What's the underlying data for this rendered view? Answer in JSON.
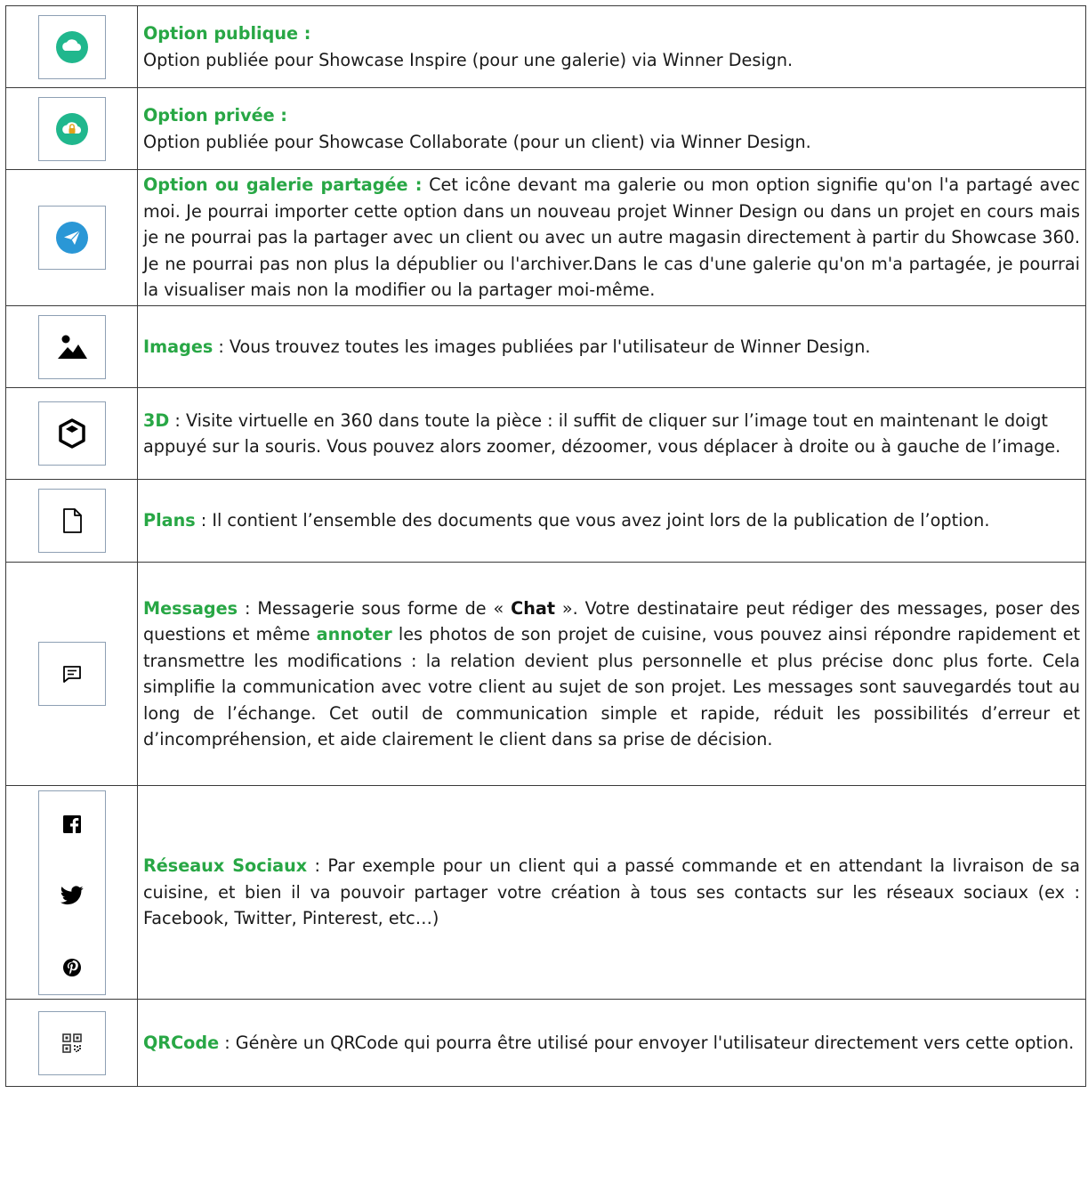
{
  "colors": {
    "accent": "#28a745",
    "icon_teal": "#20b78d",
    "icon_blue": "#2a97d6",
    "border": "#3a3a3a"
  },
  "rows": [
    {
      "icon": "cloud-icon",
      "title": "Option publique :",
      "desc": "Option publiée pour Showcase Inspire (pour une galerie) via Winner Design."
    },
    {
      "icon": "cloud-lock-icon",
      "title": "Option privée :",
      "desc": "Option publiée pour Showcase Collaborate (pour un client) via Winner Design."
    },
    {
      "icon": "send-icon",
      "title": "Option ou galerie partagée :",
      "desc": "Cet icône devant ma galerie ou mon option signifie qu'on l'a partagé avec moi. Je pourrai importer cette option dans un nouveau projet Winner Design ou dans un projet en cours mais je ne pourrai pas la partager avec un client ou avec un autre magasin directement à partir du Showcase 360. Je ne pourrai pas non plus la dépublier ou l'archiver.Dans le cas d'une galerie qu'on m'a partagée, je pourrai la visualiser mais non la modifier ou la partager moi-même."
    },
    {
      "icon": "image-icon",
      "title": "Images",
      "desc": " : Vous trouvez toutes les images publiées par l'utilisateur de Winner Design."
    },
    {
      "icon": "cube-icon",
      "title": "3D",
      "desc": " : Visite virtuelle en 360 dans toute la pièce : il suffit de cliquer sur l’image tout en maintenant le doigt appuyé sur la souris. Vous pouvez alors zoomer, dézoomer, vous déplacer à droite ou à gauche de l’image."
    },
    {
      "icon": "document-icon",
      "title": "Plans",
      "desc": " : Il contient l’ensemble des documents que vous avez joint lors de la publication de l’option."
    },
    {
      "icon": "message-icon",
      "title": "Messages",
      "desc_a": " : Messagerie sous forme de « ",
      "chat": "Chat",
      "desc_b": " ». Votre destinataire peut rédiger des messages, poser des questions et même ",
      "annoter": "annoter",
      "desc_c": " les photos de son projet de cuisine, vous pouvez ainsi répondre rapidement et transmettre les modifications : la relation devient plus personnelle et plus précise donc plus forte. Cela simplifie la communication avec votre client au sujet de son projet. Les messages sont sauvegardés tout au long de l’échange. Cet outil de communication simple et rapide, réduit les possibilités d’erreur et d’incompréhension, et aide clairement le client dans sa prise de décision."
    },
    {
      "icons": [
        "facebook-icon",
        "twitter-icon",
        "pinterest-icon"
      ],
      "title": "Réseaux Sociaux",
      "desc": " : Par exemple pour un client qui a passé commande et en attendant la livraison de sa cuisine, et bien il va pouvoir partager votre création à tous ses contacts sur les réseaux sociaux (ex : Facebook, Twitter, Pinterest, etc…)"
    },
    {
      "icon": "qrcode-icon",
      "title": "QRCode",
      "desc": " : Génère un QRCode qui pourra être utilisé pour envoyer l'utilisateur directement vers cette option."
    }
  ]
}
